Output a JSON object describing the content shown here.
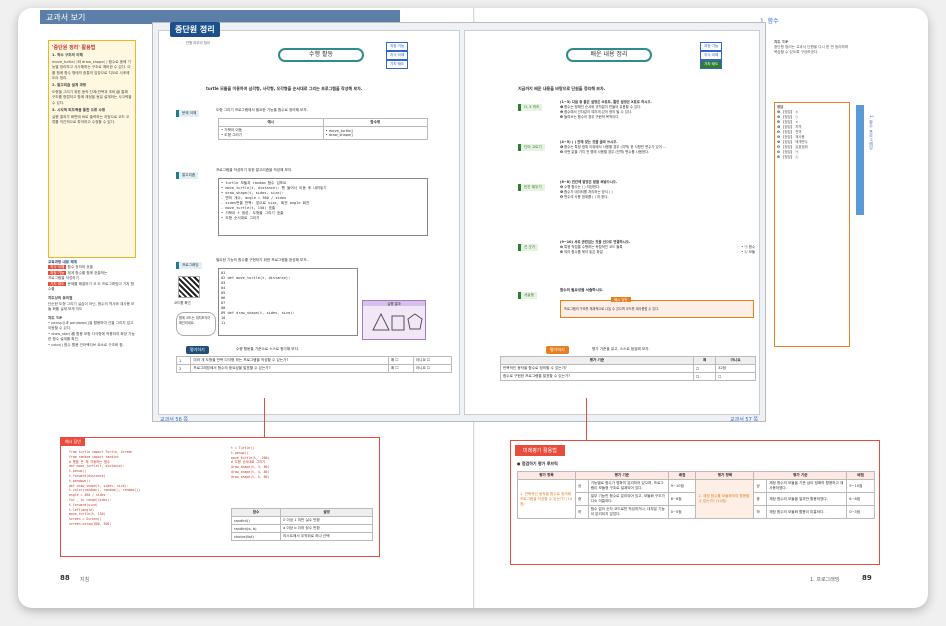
{
  "header": {
    "left_title": "교과서 보기",
    "right_title": "1. 함수"
  },
  "left_sidebar": {
    "title": "'중단원 정리' 활용법",
    "items": [
      "1. 학수 구조의 이해",
      "move_turtle( )와 draw_shape( ) 함수로 동해 기능별 정리하고 사사해하는 구조로 예비한 수 있다. 이를 함께 함수 형태의 중통의 입장으로 지오르 사후에 도야 정리.",
      "2. 알고리즘 설계 과정",
      "도형을 그리기 위한 동작 단계(반복과 추비)을 통해 구조를 정립하고 함께 재정을 동일 설계하는 사고력을 수 있다.",
      "3. 시각적 피드백을 통한 오류 수정",
      "실행 결과가 화면에 바로 출력하는 과정으로 코드 오류를 직관적으로 파악하고 수정할 수 있다."
    ],
    "tip_title": "교육과정 내용 체계",
    "tip_tags": [
      "지식·이해",
      "과정·기능",
      "가치·태도"
    ],
    "tip_lines": [
      "함수 정의와 호출",
      "체계 함수를 함께 호출하는 ",
      "프로그램을 작성하기",
      "문제를 해결하기 코 도 프로그래밍이 가치 함수를"
    ],
    "tip2_title": "지도상의 유의점",
    "tip2_text": "단순한 도형 그리기 실습이 아닌, 함수의 역사와 재사용 모듈 화를 실제 보게 지도",
    "tip3_title": "지도 TIP",
    "tip3_lines": [
      "• penup()과 pendown()을 활용하여 선을 그리지 않고 이동할 수 있다.",
      "• draw_star()를 활용 모함 다각형에 적용하여 확장 가능한 함수 설계를 확인.",
      "• color() 함수 활용 인터랙티브 요소로 구조화 함."
    ]
  },
  "left_page": {
    "badge": "중단원 정리",
    "badge_sub": "단원 마무리 정리",
    "section": "수행 활동",
    "tags": [
      "과정·기능",
      "지식·이해",
      "가치·태도"
    ],
    "intro": "turtle 모듈을 이용하여 삼각형, 사각형, 오각형을 순서대로 그리는 프로그램을 작성해 보자.",
    "step1_label": "문제 이해",
    "step1_text": "도형 그리기 프로그램에서 필요한 기능을 함수로 정의해 보자.",
    "step1_cols": [
      "예시",
      "함수명"
    ],
    "step1_left": [
      "• 거북이 이동",
      "• 도형 그리기"
    ],
    "step1_right": [
      "• move_turtle()",
      "• draw_shape()"
    ],
    "step2_label": "알고리즘",
    "step2_text": "프로그램을 작성하기 위한 알고리즘을 작성해 보자.",
    "step2_lines": [
      "• turtle 모듈과 random 함수 임포트",
      "• move_turtle(t, distance): 펜 들어서 이동 후 내려놓기",
      "• draw_shape(t, sides, size):",
      "  - 변의 개수, angle = 360 / sides",
      "  - sides번을 반복: 앞으로 size, 회전 angle 회전",
      "  - move_turtle(t, 150) 호출",
      "• 거북이 t 생성, 도형을 그리기 호출",
      "• 도형 순서대로 그리기"
    ],
    "step3_label": "프로그래밍",
    "step3_text": "필요한 기능의 함수를 구현하기 위한 프로그램을 완성해 보자.",
    "code_lines": [
      "01",
      "02",
      "03",
      "04",
      "05",
      "06",
      "07",
      "08",
      "09",
      "10",
      "11"
    ],
    "code_a": "def move_turtle(t, distance):",
    "code_b": "def draw_shape(t, sides, size):",
    "result_label": "실행 결과",
    "qr_caption": "코드를 확인",
    "tip_bubble": "함께 코드는 대치조각이 확인되세요.",
    "eval_label": "평가하기",
    "eval_text": "수행 활동을 기준으로 스스로 평가해 보자.",
    "eval_rows": [
      "여러 개 도형을 반복 다각형 하는 프로그램을 작성할 수 있는가?",
      "프로그래밍에서 함수의 중요성을 발표할 수 있는가?"
    ],
    "page_num": "교과서 56 쪽"
  },
  "right_page": {
    "section": "배운 내용 정리",
    "tags": [
      "과정·기능",
      "지식·이해",
      "가치·태도"
    ],
    "intro": "지금까지 배운 내용을 바탕으로 단원을 정리해 보자.",
    "labels": [
      "O, X 퀴즈",
      "단어 고르기",
      "빈칸 채우기",
      "선 긋기",
      "서술형"
    ],
    "q1": "(1~3) 다음 중 옳은 설명은 O표로, 틀린 설명은 X표로 하시오.",
    "q1_items": [
      "❶ 함수는 정해진 순서와 규칙없이 만들어 유용할 수 있다.",
      "❷ 함수에서 인자값이 여러개 있어 정의 될 수 있다.",
      "❸ 들여쓰는 함수의 경우 구현적 목적이다."
    ],
    "q2": "(4~5) ( ) 안에 맞는 것을 골라 쓰시오.",
    "q2_items": [
      "❹ 함수는 특정 범위 이외에서 사용할 경우 (지역) 한 사항만 변수가 있어 ...",
      "❺ 어떤 값을 가지 전 명에 사용할 경우 (전역) 변수를 사용한다."
    ],
    "q3": "(6~8) 빈칸에 알맞은 말을 써넣으시오.",
    "q3_items": [
      "❻ 수행 함수는 ( ) 저장한다.",
      "❼ 함수가 데이터를 처리하는 방식 ( )",
      "❽ 변수의 사용 범위를 ( ) 라 한다."
    ],
    "q4": "(9~10) 서로 관련있는 것을 선으로 연결하시오.",
    "q4_items": [
      "❾ 특정 작업을 수행하는 독립적인 코드 블록",
      "❿ 여러 함수를 묶어 놓은 파일"
    ],
    "q4_opts": [
      "• ㉠ 함수",
      "• ㉡ 모듈"
    ],
    "q5": "함수의 필요성을 서술하시오.",
    "example_label": "예시 답안",
    "example_text": "프로그램의 구조를 체계적으로 나눌 수 있으며 코드를 재사용할 수 있다.",
    "eval_label": "평가하기",
    "eval_text": "평가 기준을 읽고, 스스로 점검해 보자.",
    "eval_cols": [
      "평가 기준",
      "예",
      "아니요"
    ],
    "eval_rows": [
      "반복적인 동작을 함수로 정의할 수 있는가?",
      "함수로 구현한 프로그램을 발표할 수 있는가?"
    ],
    "score": "32점",
    "page_num": "교과서 57 쪽"
  },
  "right_sidebar": {
    "tip_title": "지도 TIP",
    "tip_text": "중단원 정리는 교과서 단원을 다시 한 번 정리하며 복습할 수 있도록 구성하였다.",
    "answer_title": "정답",
    "answers": [
      "❶ 【정답】 ×",
      "❷ 【정답】 ○",
      "❸ 【정답】 ×",
      "❹ 【정답】 지역",
      "❺ 【정답】 전역",
      "❻ 【정답】 재사용",
      "❼ 【정답】 매개변수",
      "❽ 【정답】 유효범위",
      "❾ 【정답】 ㉠",
      "❿ 【정답】 ㉡"
    ],
    "chapter_tab": "1. 함수 프로그래밍"
  },
  "bottom_left": {
    "label": "예시 답안",
    "code": [
      "from turtle import Turtle, Screen",
      "from random import randint",
      "# 펜을 든 채 이동하는 함수",
      "def move_turtle(t, distance):",
      "    t.penup()",
      "    t.forward(distance)",
      "    t.pendown()",
      "def draw_shape(t, sides, size):",
      "    t.color(random(), random(), random())",
      "    angle = 360 / sides",
      "    for _ in range(sides):",
      "        t.forward(size)",
      "        t.left(angle)",
      "    move_turtle(t, 150)",
      "screen = Screen()",
      "screen.setup(800, 300)"
    ],
    "code2": [
      "t = Turtle()",
      "t.penup()",
      "move_turtle(t, -200)",
      "# 도형 순서대로 그리기",
      "draw_shape(t, 3, 80)",
      "draw_shape(t, 4, 80)",
      "draw_shape(t, 5, 80)"
    ],
    "table_cols": [
      "함수",
      "설명"
    ],
    "table_rows": [
      [
        "randint()",
        "0 이상 1 미만 실수 반환"
      ],
      [
        "randint(a, b)",
        "a 이상 b 이하 정수 반환"
      ],
      [
        "choice(list)",
        "리스트에서 무작위로 하나 선택"
      ]
    ],
    "page_num": "88",
    "page_sub": "지침"
  },
  "bottom_right": {
    "banner": "미래평가 활용법",
    "subtitle": "● 점검하기 평가 루브릭",
    "cols": [
      "평가 항목",
      "평가 기준",
      "배점",
      "평가 항목",
      "평가 기준",
      "배점"
    ],
    "left_item": "1. 반복적인 동작을 함수로 정의해 프로그램을 작성할 수 있는가? (10점)",
    "right_item": "2. 재정 함수를 모듈화하여 활용할 수 있는가? (10점)",
    "levels": [
      "상",
      "중",
      "하"
    ],
    "left_criteria": [
      "기능별로 함수가 명확히 분리되어 있으며, 프로그램이 모듈형 구조로 설계되어 있다.",
      "일부 기능만 함수로 분리되어 있고, 모듈화 구조가 다소 미흡하다.",
      "함수 없이 순차 코드로만 작성하거나, 대부분 기능이 분리되지 않았다."
    ],
    "right_criteria": [
      "재정 함수의 모듈을 기준 삼아 정확히 활용하고 재사용하였다.",
      "재정 함수의 모듈을 일부만 활용하였다.",
      "재정 함수의 모듈화 활용이 미흡하다."
    ],
    "scores_left": [
      "9~10점",
      "6~8점",
      "0~5점"
    ],
    "scores_right": [
      "9~10점",
      "6~8점",
      "0~5점"
    ],
    "page_num": "89",
    "page_sub": "1. 프로그래밍"
  }
}
